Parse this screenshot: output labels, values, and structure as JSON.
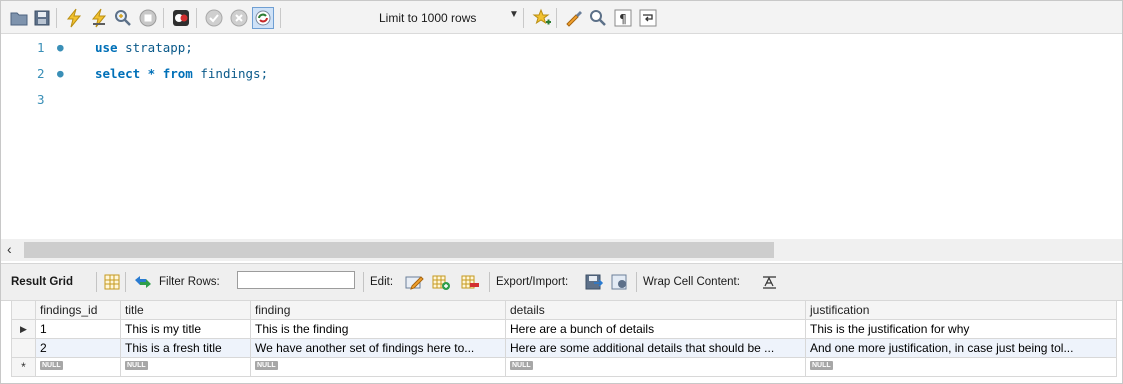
{
  "toolbar": {
    "limit_label": "Limit to 1000 rows",
    "icons": [
      "open-folder-icon",
      "save-icon",
      "execute-icon",
      "execute-current-icon",
      "explain-icon",
      "stop-icon",
      "toggle-error-icon",
      "commit-icon",
      "rollback-icon",
      "autocommit-icon",
      "limit-dropdown-icon",
      "beautify-icon",
      "find-icon",
      "invisible-chars-icon",
      "wrap-icon"
    ]
  },
  "editor": {
    "lines": [
      {
        "number": "1",
        "keyword": "use",
        "rest": " stratapp;",
        "has_dot": true
      },
      {
        "number": "2",
        "keyword": "select * from",
        "rest": " findings;",
        "has_dot": true
      },
      {
        "number": "3",
        "keyword": "",
        "rest": "",
        "has_dot": false
      }
    ]
  },
  "result_toolbar": {
    "result_grid_label": "Result Grid",
    "filter_rows_label": "Filter Rows:",
    "filter_value": "",
    "edit_label": "Edit:",
    "export_label": "Export/Import:",
    "wrap_label": "Wrap Cell Content:"
  },
  "grid": {
    "columns": [
      "findings_id",
      "title",
      "finding",
      "details",
      "justification"
    ],
    "rows": [
      [
        "1",
        "This is my title",
        "This is the finding",
        "Here are a bunch of details",
        "This is the justification for why"
      ],
      [
        "2",
        "This is a fresh title",
        "We have another set of findings here to...",
        "Here are some additional details that should be ...",
        "And one more justification, in case just being tol..."
      ]
    ],
    "null_label": "NULL",
    "new_row_marker": "*",
    "current_row_marker": "▶"
  },
  "colors": {
    "keyword": "#0070b8",
    "line_number": "#3a8fb7",
    "toolbar_bg": "#f3f3f3",
    "alt_row": "#eef3fb"
  }
}
